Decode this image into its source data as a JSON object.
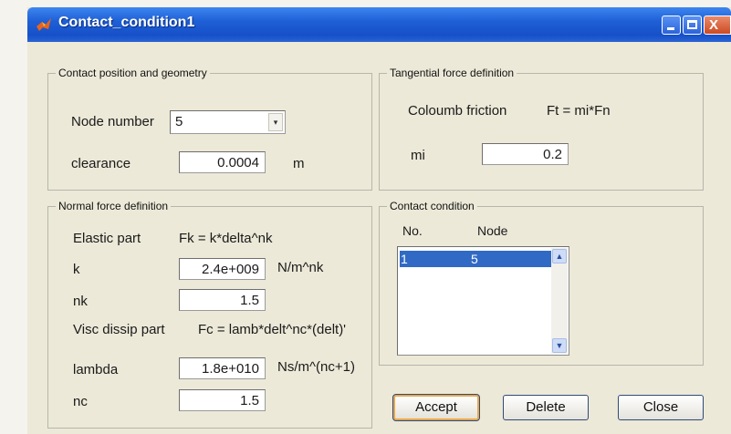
{
  "window": {
    "title": "Contact_condition1",
    "controls": {
      "minimize_icon": "minimize-icon",
      "maximize_icon": "maximize-icon",
      "close_icon": "close-icon",
      "close_glyph": "X"
    }
  },
  "contact_position": {
    "legend": "Contact position and geometry",
    "node_number_label": "Node number",
    "node_number_value": "5",
    "clearance_label": "clearance",
    "clearance_value": "0.0004",
    "clearance_unit": "m"
  },
  "tangential": {
    "legend": "Tangential force definition",
    "friction_label": "Coloumb friction",
    "friction_formula": "Ft = mi*Fn",
    "mi_label": "mi",
    "mi_value": "0.2"
  },
  "normal_force": {
    "legend": "Normal force definition",
    "elastic_label": "Elastic part",
    "elastic_formula": "Fk = k*delta^nk",
    "k_label": "k",
    "k_value": "2.4e+009",
    "k_unit": "N/m^nk",
    "nk_label": "nk",
    "nk_value": "1.5",
    "visc_label": "Visc dissip part",
    "visc_formula": "Fc = lamb*delt^nc*(delt)'",
    "lambda_label": "lambda",
    "lambda_value": "1.8e+010",
    "lambda_unit": "Ns/m^(nc+1)",
    "nc_label": "nc",
    "nc_value": "1.5"
  },
  "contact_condition": {
    "legend": "Contact condition",
    "col_no": "No.",
    "col_node": "Node",
    "rows": [
      {
        "no": "1",
        "node": "5"
      }
    ]
  },
  "buttons": {
    "accept": "Accept",
    "delete": "Delete",
    "close": "Close"
  },
  "colors": {
    "titlebar": "#1f5fd6",
    "selection": "#316ac5",
    "dialog_bg": "#ece9d8"
  }
}
